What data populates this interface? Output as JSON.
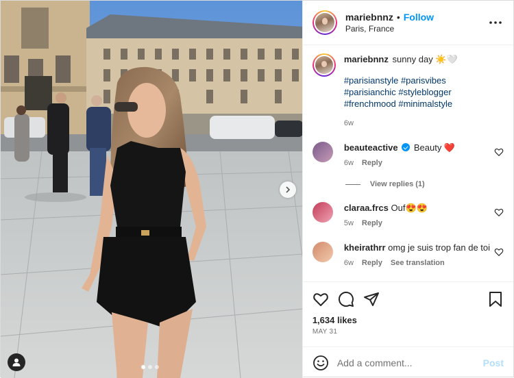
{
  "header": {
    "username": "mariebnnz",
    "separator": "•",
    "follow_label": "Follow",
    "location": "Paris, France"
  },
  "caption": {
    "username": "mariebnnz",
    "text": "sunny day ☀️🤍",
    "hashtags": [
      "#parisianstyle",
      "#parisvibes",
      "#parisianchic",
      "#styleblogger",
      "#frenchmood",
      "#minimalstyle"
    ],
    "time": "6w"
  },
  "comments": [
    {
      "username": "beauteactive",
      "verified": true,
      "text": "Beauty ❤️",
      "time": "6w",
      "reply_label": "Reply"
    },
    {
      "username": "claraa.frcs",
      "verified": false,
      "text": "Ouf😍😍",
      "time": "5w",
      "reply_label": "Reply"
    },
    {
      "username": "kheirathrr",
      "verified": false,
      "text": "omg je suis trop fan de toi",
      "time": "6w",
      "reply_label": "Reply",
      "translate_label": "See translation"
    }
  ],
  "view_replies_label": "View replies (1)",
  "likes": "1,634 likes",
  "post_date": "MAY 31",
  "add_comment": {
    "placeholder": "Add a comment...",
    "post_label": "Post"
  },
  "icons": {
    "more": "more-horizontal-icon",
    "like": "heart-icon",
    "comment": "comment-bubble-icon",
    "share": "paper-plane-icon",
    "save": "bookmark-icon",
    "emoji": "smiley-icon",
    "next": "chevron-right-icon",
    "tag": "user-tag-icon"
  },
  "colors": {
    "accent": "#0095f6",
    "hashtag": "#00376b",
    "muted": "#737373",
    "heart": "#ed4956"
  },
  "carousel": {
    "total": 3,
    "active": 1
  }
}
